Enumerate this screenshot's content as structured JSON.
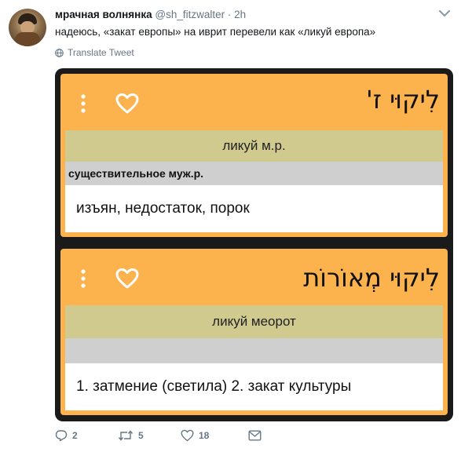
{
  "tweet": {
    "display_name": "мрачная волнянка",
    "handle": "@sh_fitzwalter",
    "dot": "·",
    "time": "2h",
    "text": "надеюсь, «закат европы» на иврит перевели как «ликуй европа»",
    "translate_label": "Translate Tweet"
  },
  "cards": [
    {
      "hebrew": "לִיקוּי ז'",
      "transliteration": "ликуй м.р.",
      "part_of_speech": "существительное муж.р.",
      "meaning": "изъян, недостаток, порок"
    },
    {
      "hebrew": "לִיקוּי מְאוֹרוֹת",
      "transliteration": "ликуй меорот",
      "part_of_speech": "",
      "meaning": "1. затмение (светила)  2. закат культуры"
    }
  ],
  "actions": {
    "replies": "2",
    "retweets": "5",
    "likes": "18"
  },
  "colors": {
    "card_bg": "#fcb34e",
    "translit_bg": "#d1ca8f",
    "pos_bg": "#cfcfcf",
    "media_bg": "#1a1a1a",
    "secondary_text": "#657786"
  },
  "icons": [
    "avatar",
    "chevron-down-icon",
    "globe-icon",
    "more-vertical-icon",
    "heart-outline-icon",
    "reply-icon",
    "retweet-icon",
    "like-icon",
    "direct-message-icon"
  ]
}
